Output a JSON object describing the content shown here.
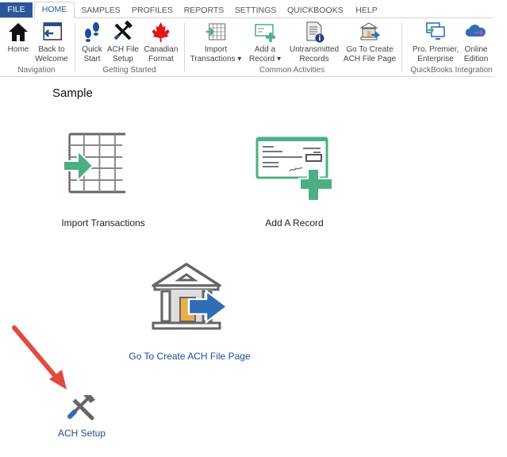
{
  "ribbon_tabs": [
    "FILE",
    "HOME",
    "SAMPLES",
    "PROFILES",
    "REPORTS",
    "SETTINGS",
    "QUICKBOOKS",
    "HELP"
  ],
  "active_tab": "HOME",
  "ribbon": {
    "buttons": [
      {
        "l1": "Home",
        "l2": "",
        "icon": "home-icon"
      },
      {
        "l1": "Back to",
        "l2": "Welcome",
        "icon": "back-window-icon"
      },
      {
        "l1": "Quick",
        "l2": "Start",
        "icon": "footprints-icon"
      },
      {
        "l1": "ACH File",
        "l2": "Setup",
        "icon": "tools-icon"
      },
      {
        "l1": "Canadian",
        "l2": "Format",
        "icon": "maple-leaf-icon"
      },
      {
        "l1": "Import",
        "l2": "Transactions ▾",
        "icon": "import-grid-icon"
      },
      {
        "l1": "Add a",
        "l2": "Record ▾",
        "icon": "check-add-icon"
      },
      {
        "l1": "Untransmitted",
        "l2": "Records",
        "icon": "document-info-icon"
      },
      {
        "l1": "Go To Create",
        "l2": "ACH File Page",
        "icon": "bank-arrow-icon"
      },
      {
        "l1": "Pro, Premier,",
        "l2": "Enterprise",
        "icon": "desktop-sync-icon"
      },
      {
        "l1": "Online",
        "l2": "Edition",
        "icon": "cloud-arrow-icon"
      }
    ],
    "groups": [
      "Navigation",
      "Getting Started",
      "Common Activities",
      "QuickBooks Integration"
    ]
  },
  "main": {
    "title": "Sample",
    "tiles": {
      "import": "Import Transactions",
      "add": "Add A Record",
      "goto": "Go To Create ACH File Page",
      "setup": "ACH Setup"
    }
  },
  "colors": {
    "file_tab": "#2b579a",
    "green": "#4caf84",
    "link_blue": "#1f4e99",
    "arrow_red": "#e04a3f"
  }
}
